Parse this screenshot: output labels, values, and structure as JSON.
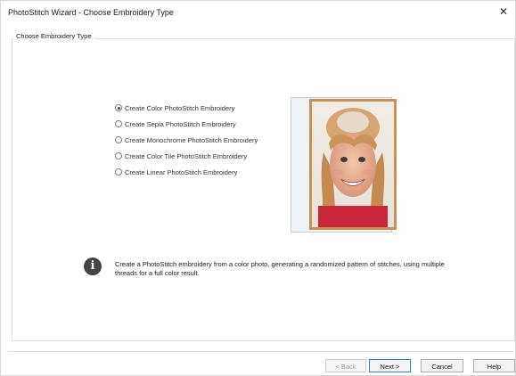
{
  "window": {
    "title": "PhotoStitch Wizard - Choose Embroidery Type",
    "close_glyph": "✕"
  },
  "group": {
    "legend": "Choose Embroidery Type"
  },
  "options": [
    {
      "label": "Create Color PhotoStitch Embroidery",
      "selected": true
    },
    {
      "label": "Create Sepia PhotoStitch Embroidery",
      "selected": false
    },
    {
      "label": "Create Monochrome PhotoStitch Embroidery",
      "selected": false
    },
    {
      "label": "Create Color Tile PhotoStitch Embroidery",
      "selected": false
    },
    {
      "label": "Create Linear PhotoStitch Embroidery",
      "selected": false
    }
  ],
  "info": {
    "icon": "info-icon",
    "glyph": "i",
    "text": "Create a PhotoStitch embroidery from a color photo, generating a randomized pattern of stitches, using multiple threads for a full color result."
  },
  "buttons": {
    "back": "< Back",
    "next": "Next >",
    "cancel": "Cancel",
    "help": "Help"
  }
}
